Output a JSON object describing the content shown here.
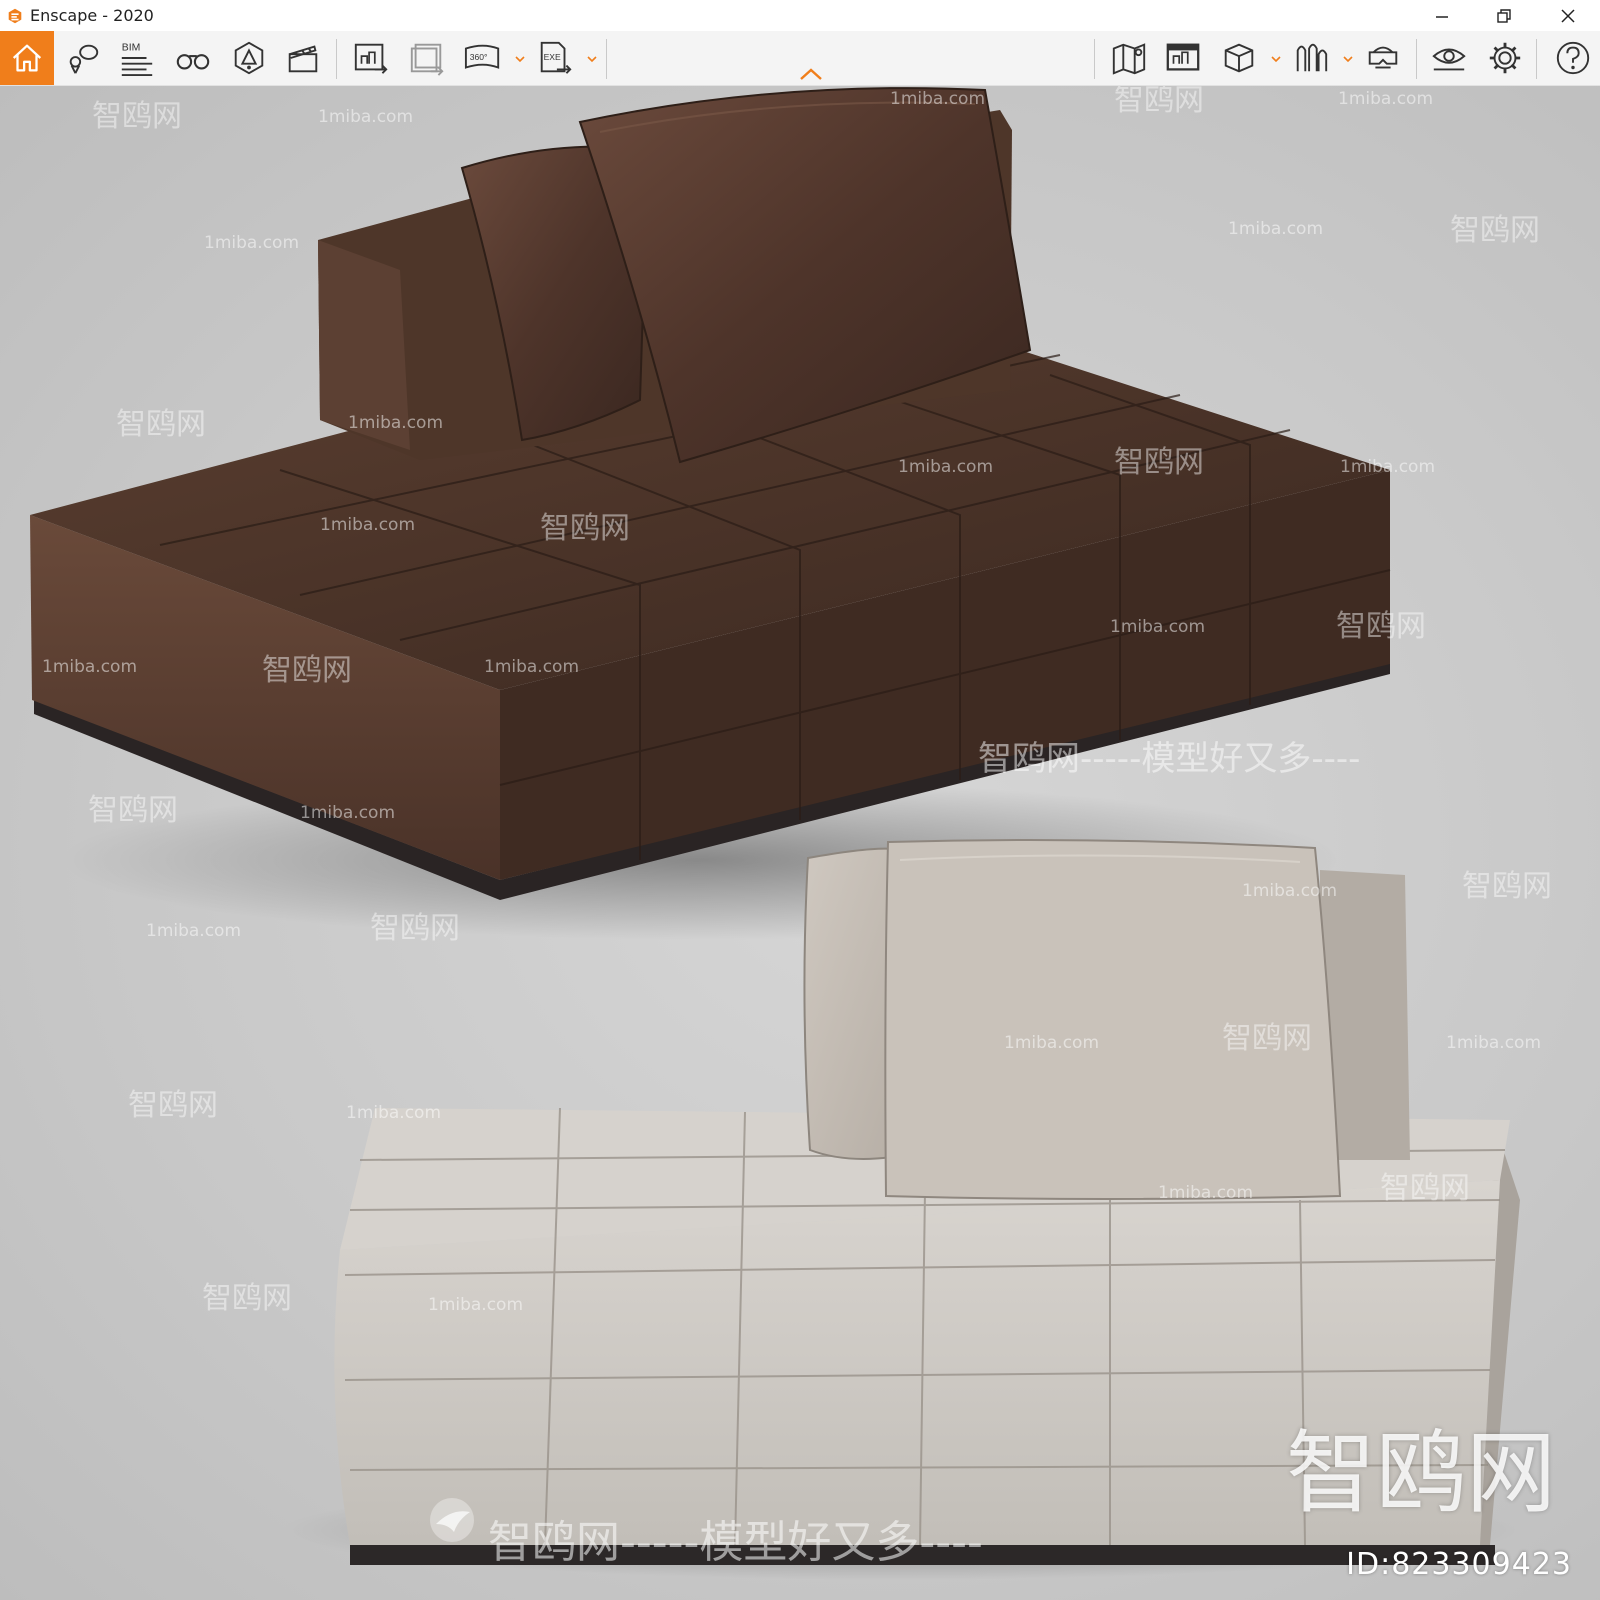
{
  "window": {
    "title": "Enscape - 2020",
    "accent_color": "#f07e1b",
    "minimize_icon": "minimize-icon",
    "restore_icon": "restore-icon",
    "close_icon": "close-icon"
  },
  "toolbar": {
    "bim_label": "BIM",
    "panorama_label": "360°",
    "exe_label": "EXE",
    "icons": [
      "home-icon",
      "map-pin-icon",
      "bim-icon",
      "binoculars-icon",
      "sun-icon",
      "clapper-icon",
      "render-image-icon",
      "batch-render-icon",
      "panorama-icon",
      "exe-export-icon",
      "map-icon",
      "screenshot-icon",
      "cube-icon",
      "asset-library-icon",
      "vr-headset-icon",
      "visibility-icon",
      "gear-icon",
      "help-icon"
    ]
  },
  "viewport": {
    "watermark_site": "1miba.com",
    "watermark_brand": "智鸥网",
    "watermark_slogan": "智鸥网-----模型好又多----",
    "watermark_slogan_mid": "智鸥网-----模型好又多----",
    "big_watermark": "智鸥网",
    "id_text": "ID:823309423"
  }
}
